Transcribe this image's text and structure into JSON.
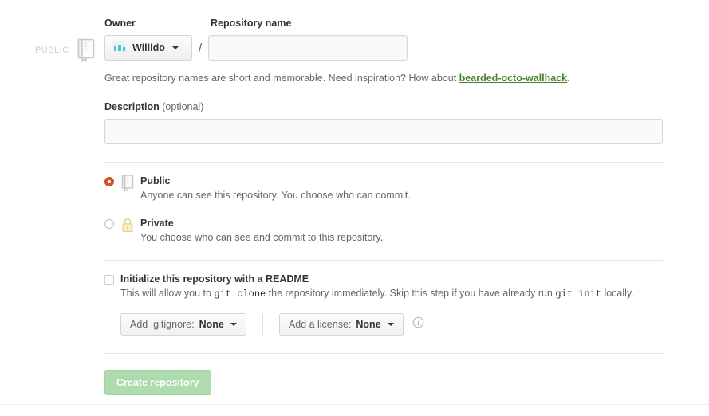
{
  "visibility_badge": {
    "label": "PUBLIC",
    "icon": "repo-book-icon"
  },
  "owner_field": {
    "label": "Owner",
    "selected_owner": "Willido",
    "avatar_icon": "identicon-avatar",
    "caret_icon": "chevron-down-icon",
    "separator": "/"
  },
  "repository_name_field": {
    "label": "Repository name",
    "value": "",
    "placeholder": ""
  },
  "hint": {
    "prefix": "Great repository names are short and memorable. Need inspiration? How about ",
    "suggestion": "bearded-octo-wallhack",
    "suffix": "."
  },
  "description_field": {
    "label": "Description",
    "optional_label": "(optional)",
    "value": "",
    "placeholder": ""
  },
  "visibility_options": [
    {
      "id": "public",
      "title": "Public",
      "description": "Anyone can see this repository. You choose who can commit.",
      "icon": "repo-book-icon",
      "selected": true
    },
    {
      "id": "private",
      "title": "Private",
      "description": "You choose who can see and commit to this repository.",
      "icon": "lock-icon",
      "selected": false
    }
  ],
  "readme_option": {
    "title": "Initialize this repository with a README",
    "desc_part1": "This will allow you to ",
    "code1": "git clone",
    "desc_part2": " the repository immediately. Skip this step if you have already run ",
    "code2": "git init",
    "desc_part3": " locally.",
    "checked": false
  },
  "gitignore_dropdown": {
    "prefix": "Add .gitignore:",
    "value": "None",
    "caret_icon": "chevron-down-icon"
  },
  "license_dropdown": {
    "prefix": "Add a license:",
    "value": "None",
    "caret_icon": "chevron-down-icon"
  },
  "license_info": {
    "icon": "info-icon"
  },
  "submit_button": {
    "label": "Create repository",
    "disabled": true
  },
  "colors": {
    "accent_green": "#4a7f2c",
    "radio_selected": "#d9542b",
    "button_disabled_bg": "#aedcae",
    "lock_yellow": "#f6e9b8",
    "avatar_teal": "#45c6d6",
    "divider": "#e5e5e5",
    "muted_text": "#666666"
  }
}
